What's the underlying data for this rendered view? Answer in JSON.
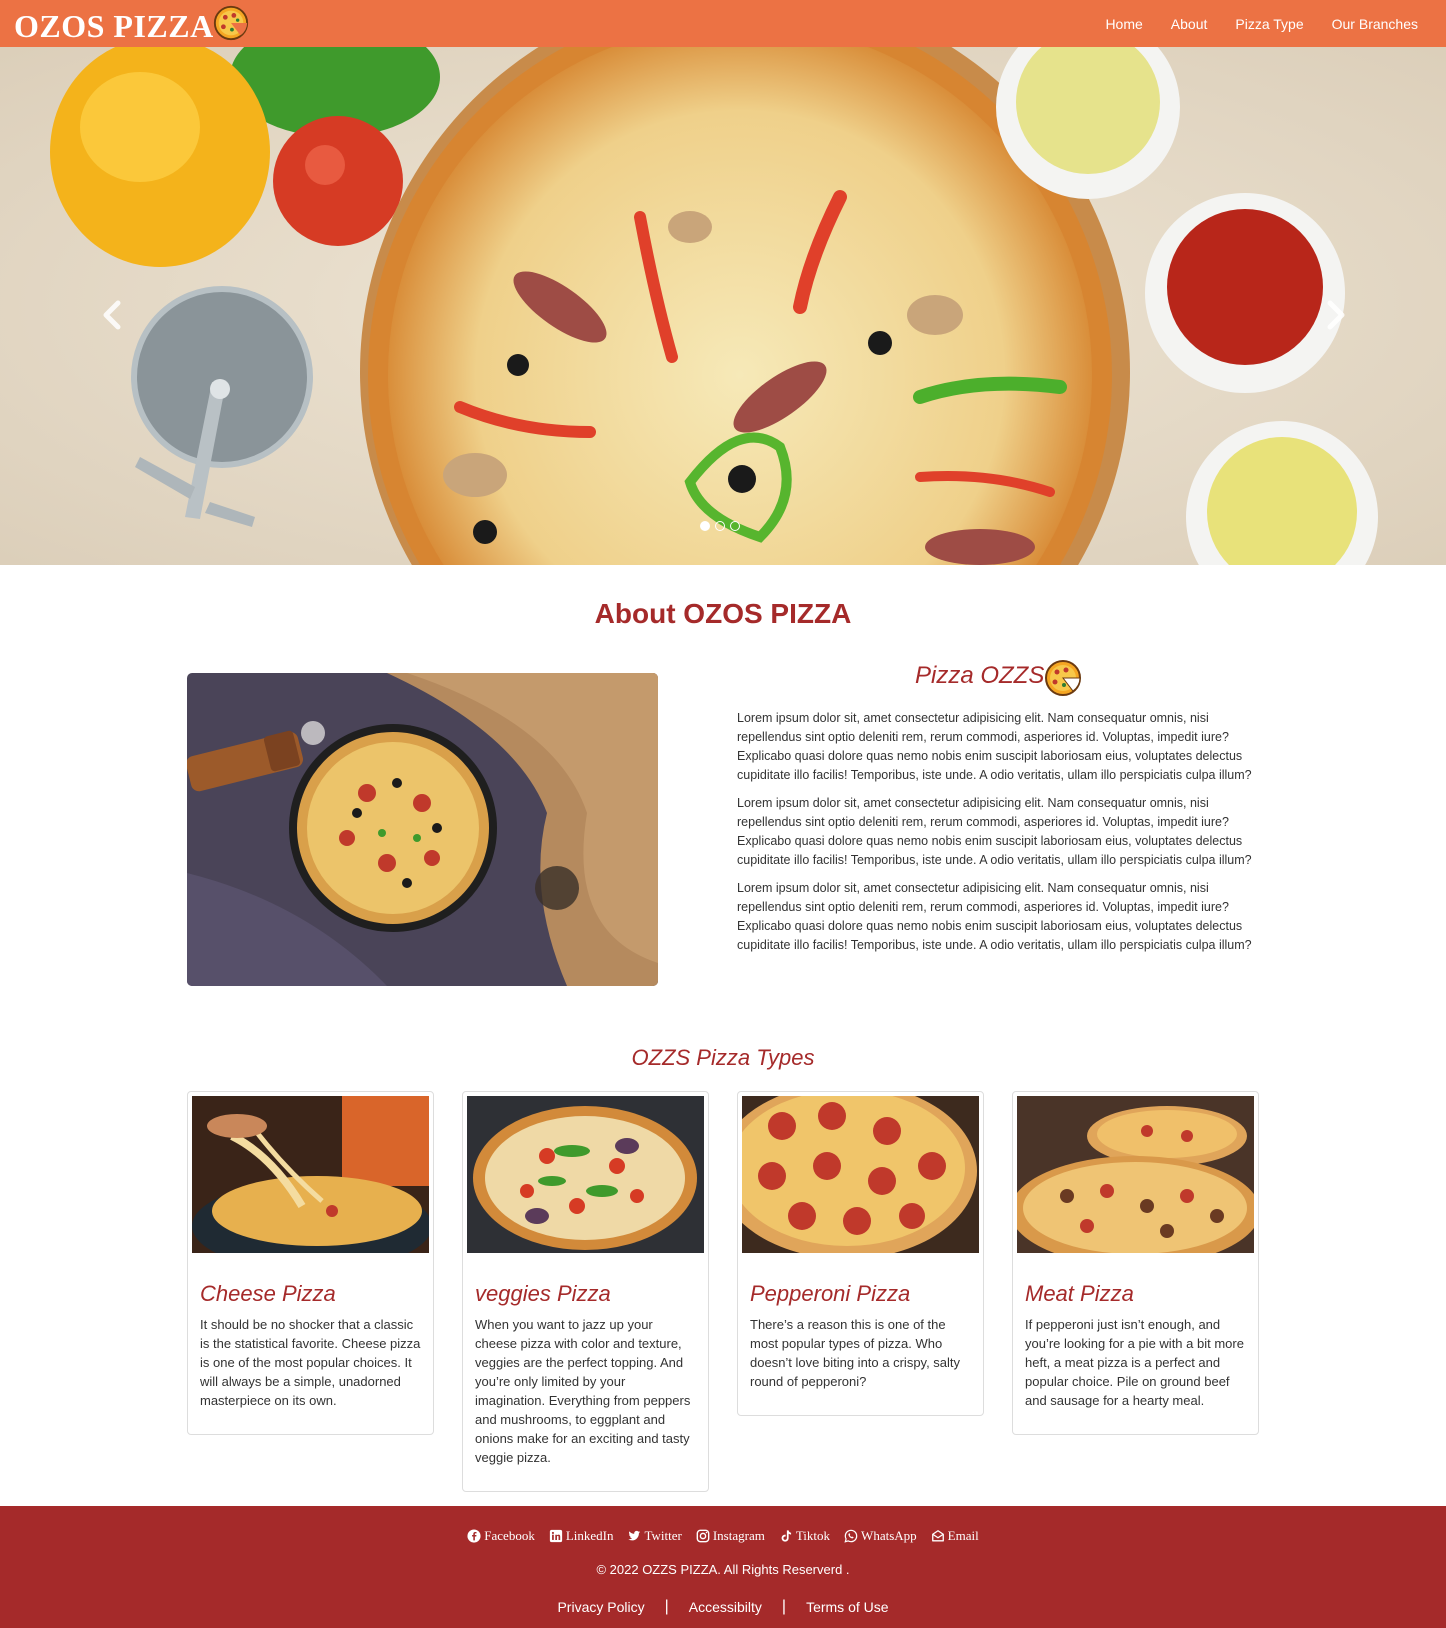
{
  "navbar": {
    "brand": "OZOS PIZZA",
    "brand_icon": "pizza-icon",
    "links": [
      "Home",
      "About",
      "Pizza Type",
      "Our Branches"
    ]
  },
  "hero": {
    "image": "pizza-with-peppers-and-sauces",
    "indicators": 3,
    "active_indicator": 0
  },
  "about": {
    "title": "About OZOS PIZZA",
    "subtitle": "Pizza OZZS",
    "subtitle_icon": "pizza-icon",
    "paragraphs": [
      "Lorem ipsum dolor sit, amet consectetur adipisicing elit. Nam consequatur omnis, nisi repellendus sint optio deleniti rem, rerum commodi, asperiores id. Voluptas, impedit iure? Explicabo quasi dolore quas nemo nobis enim suscipit laboriosam eius, voluptates delectus cupiditate illo facilis! Temporibus, iste unde. A odio veritatis, ullam illo perspiciatis culpa illum?",
      "Lorem ipsum dolor sit, amet consectetur adipisicing elit. Nam consequatur omnis, nisi repellendus sint optio deleniti rem, rerum commodi, asperiores id. Voluptas, impedit iure? Explicabo quasi dolore quas nemo nobis enim suscipit laboriosam eius, voluptates delectus cupiditate illo facilis! Temporibus, iste unde. A odio veritatis, ullam illo perspiciatis culpa illum?",
      "Lorem ipsum dolor sit, amet consectetur adipisicing elit. Nam consequatur omnis, nisi repellendus sint optio deleniti rem, rerum commodi, asperiores id. Voluptas, impedit iure? Explicabo quasi dolore quas nemo nobis enim suscipit laboriosam eius, voluptates delectus cupiditate illo facilis! Temporibus, iste unde. A odio veritatis, ullam illo perspiciatis culpa illum?"
    ]
  },
  "types": {
    "title": "OZZS Pizza Types",
    "cards": [
      {
        "title": "Cheese Pizza",
        "text": "It should be no shocker that a classic is the statistical favorite. Cheese pizza is one of the most popular choices. It will always be a simple, unadorned masterpiece on its own."
      },
      {
        "title": "veggies Pizza",
        "text": "When you want to jazz up your cheese pizza with color and texture, veggies are the perfect topping. And you’re only limited by your imagination. Everything from peppers and mushrooms, to eggplant and onions make for an exciting and tasty veggie pizza."
      },
      {
        "title": "Pepperoni Pizza",
        "text": "There’s a reason this is one of the most popular types of pizza. Who doesn’t love biting into a crispy, salty round of pepperoni?"
      },
      {
        "title": "Meat Pizza",
        "text": "If pepperoni just isn’t enough, and you’re looking for a pie with a bit more heft, a meat pizza is a perfect and popular choice. Pile on ground beef and sausage for a hearty meal."
      }
    ]
  },
  "footer": {
    "social": [
      "Facebook",
      "LinkedIn",
      "Twitter",
      "Instagram",
      "Tiktok",
      "WhatsApp",
      "Email"
    ],
    "copyright": "© 2022 OZZS PIZZA. All Rights Reserverd .",
    "legal": [
      "Privacy Policy",
      "Accessibilty",
      "Terms of Use"
    ],
    "color": "#a52a2a"
  },
  "colors": {
    "navbar": "#ec7244",
    "accent": "#a52a2a"
  }
}
